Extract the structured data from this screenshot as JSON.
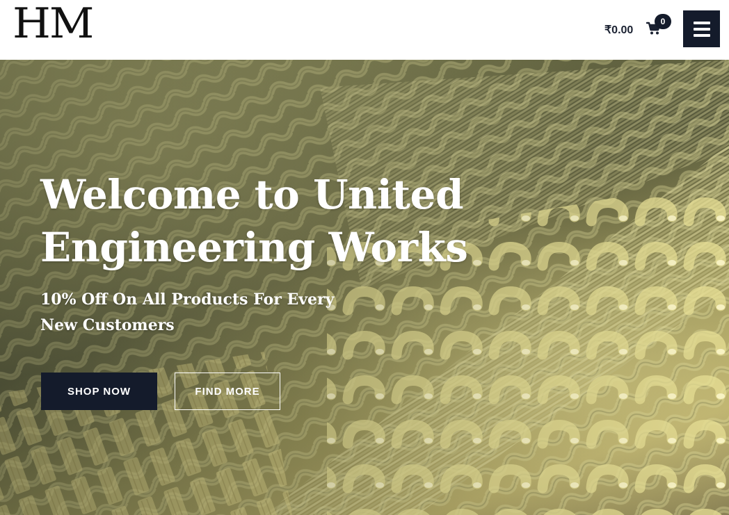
{
  "header": {
    "logo_text": "HM",
    "cart_total": "₹0.00",
    "cart_count": "0",
    "cart_icon": "shopping-cart-icon",
    "menu_icon": "hamburger-menu-icon"
  },
  "hero": {
    "title": "Welcome to United Engineering Works",
    "subtitle": "10% Off On All Products For Every New Customers",
    "primary_button": "SHOP NOW",
    "secondary_button": "FIND MORE",
    "background_image": "pasta-varieties-photo"
  },
  "colors": {
    "brand_dark": "#141b2b",
    "text_light": "#ffffff"
  }
}
